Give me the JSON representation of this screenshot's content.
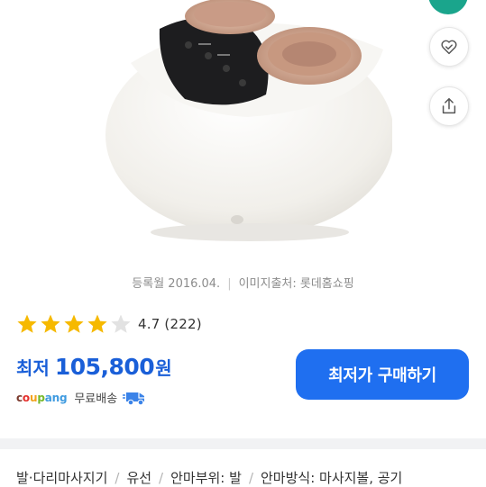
{
  "product": {
    "image_alt": "foot massager"
  },
  "source": {
    "registered": "등록월 2016.04.",
    "image_source": "이미지출처: 롯데홈쇼핑"
  },
  "rating": {
    "stars": 4.7,
    "text": "4.7 (222)"
  },
  "price": {
    "label": "최저",
    "amount": "105,800",
    "unit": "원"
  },
  "shipping": {
    "seller": "coupang",
    "text": "무료배송"
  },
  "buy_button": {
    "label": "최저가 구매하기"
  },
  "specs": [
    "발·다리마사지기",
    "유선",
    "안마부위: 발",
    "안마방식: 마사지볼, 공기"
  ],
  "colors": {
    "accent": "#1f6ff0",
    "price": "#1a5fd8",
    "star": "#f6b900",
    "teal": "#1aa58c"
  },
  "icons": [
    "heart-check-icon",
    "share-icon",
    "star-icon",
    "rocket-delivery-icon"
  ]
}
